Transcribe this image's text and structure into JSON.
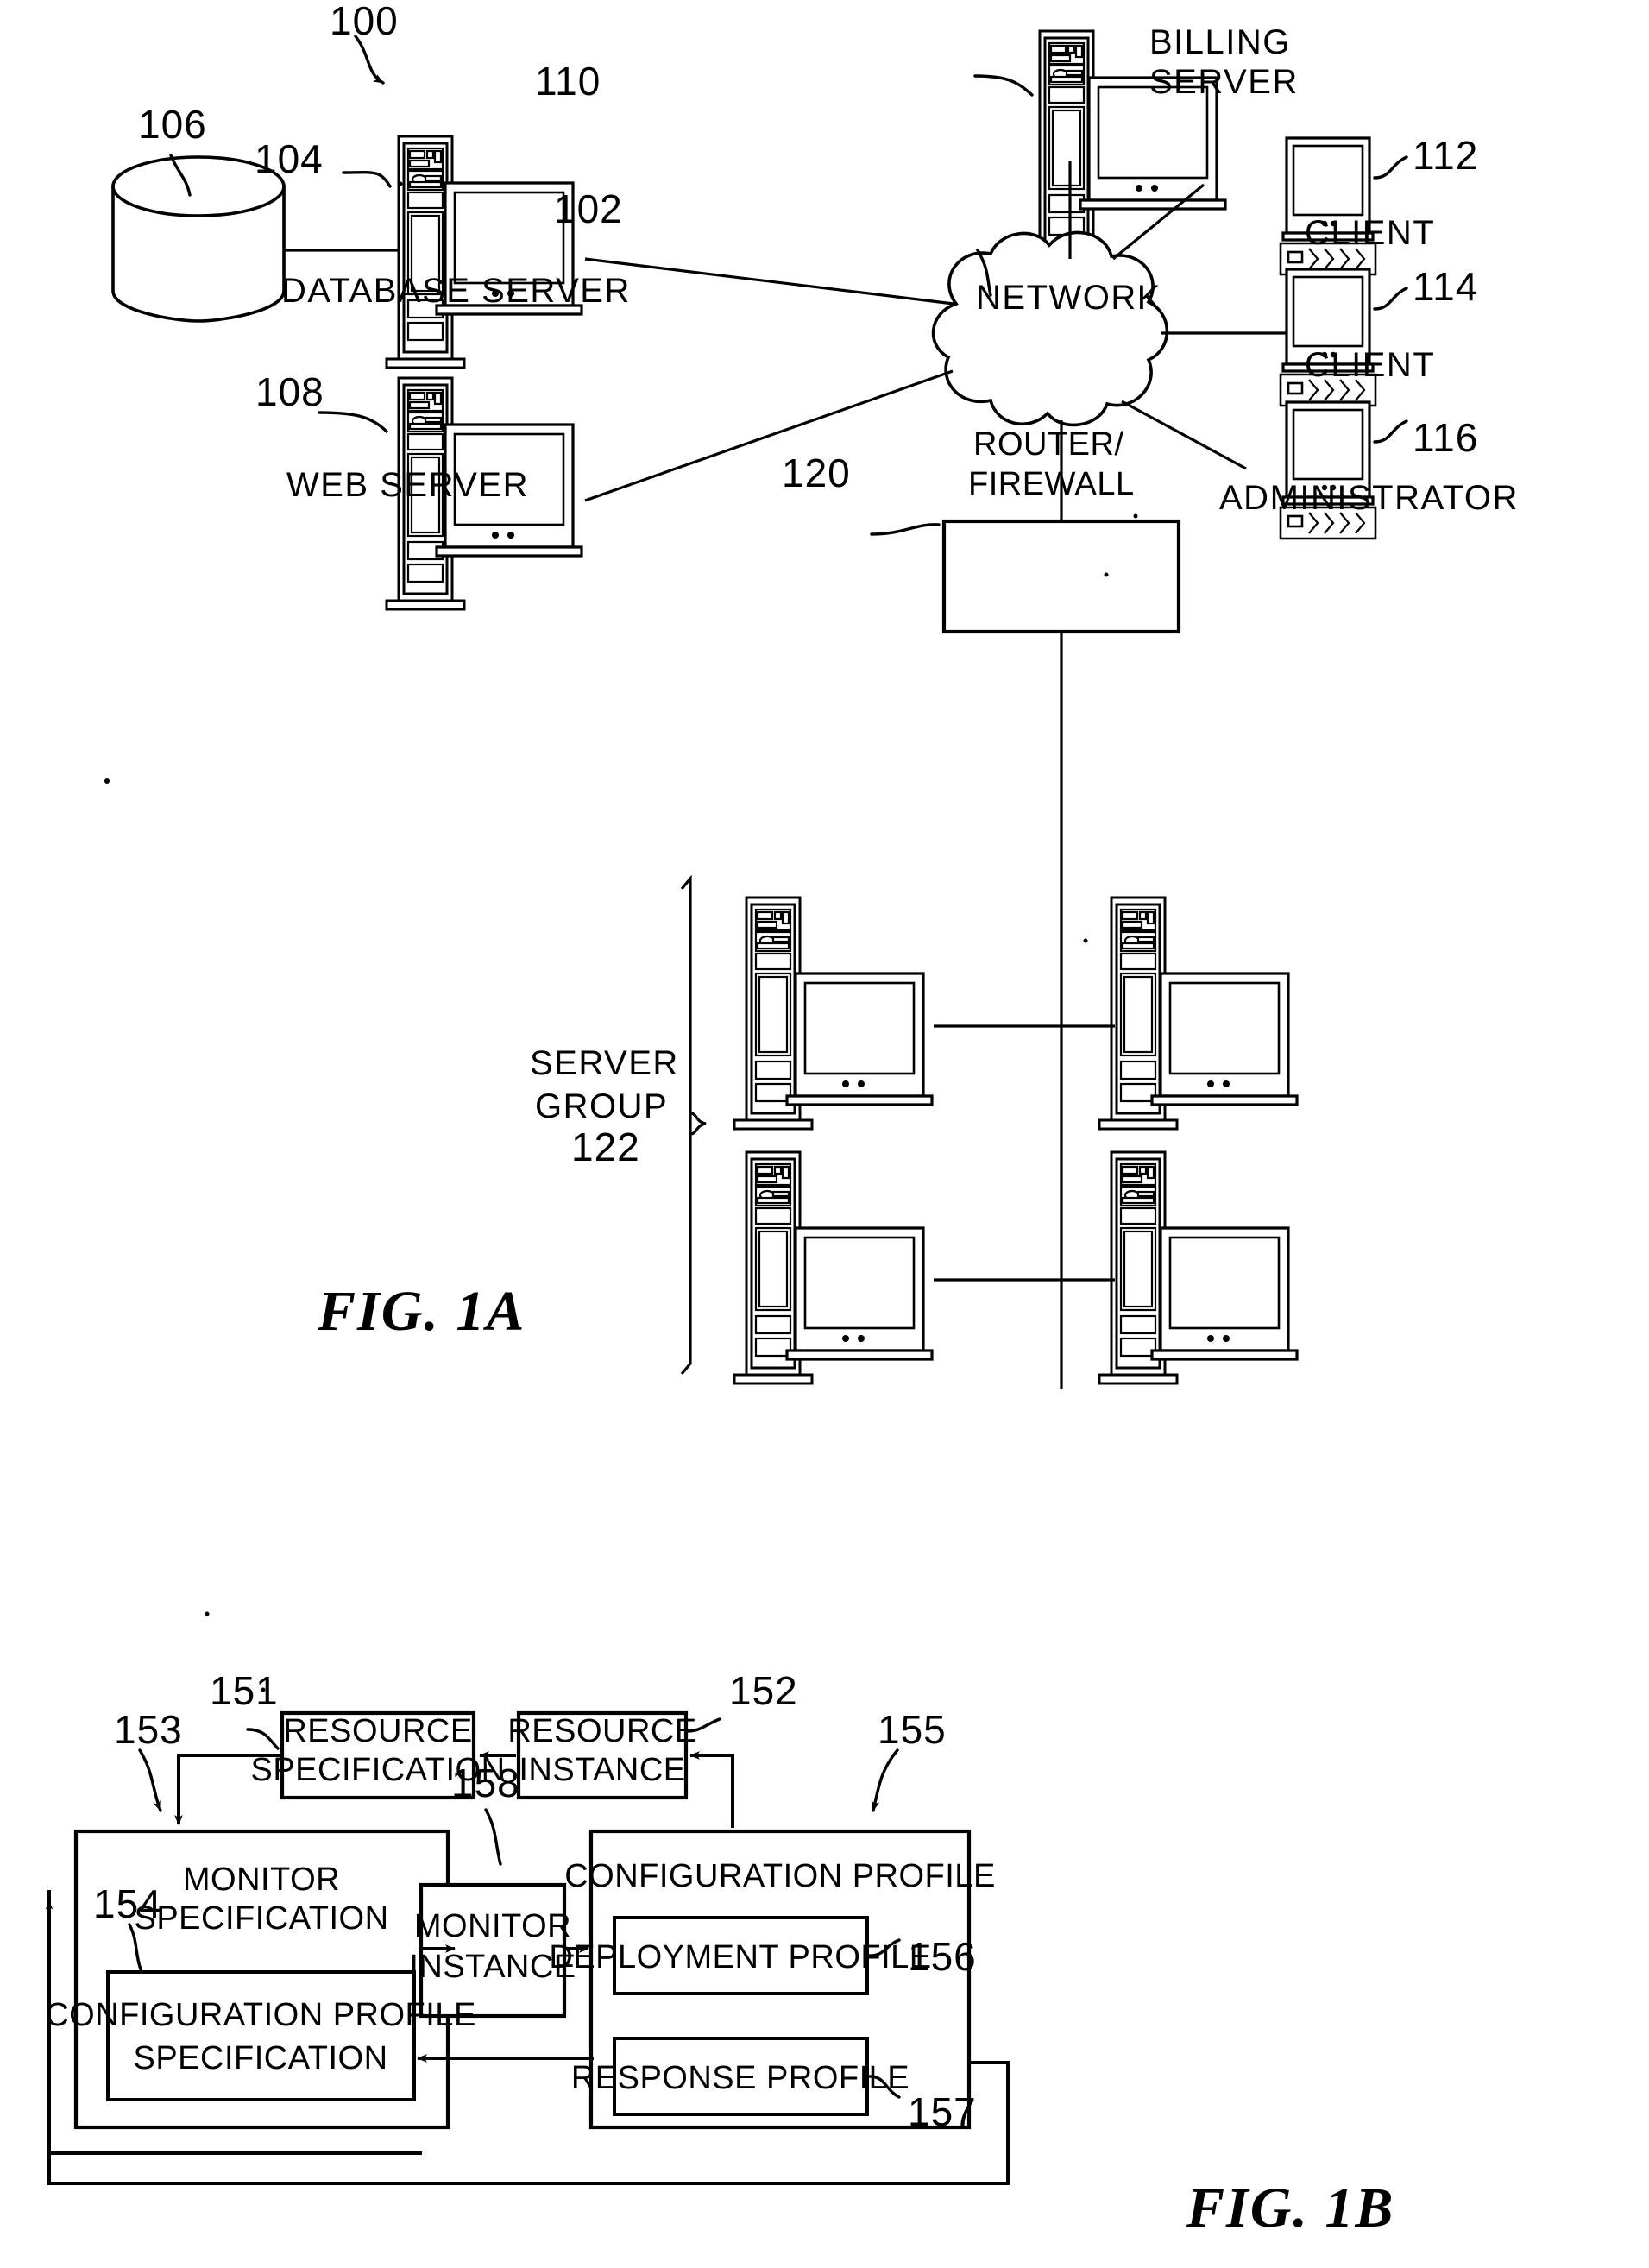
{
  "figures": [
    {
      "id": "fig-1a",
      "caption": "FIG. 1A",
      "system_ref": "100",
      "nodes": [
        {
          "ref": "106",
          "label": "",
          "type": "storage-cylinder"
        },
        {
          "ref": "104",
          "label": "DATABASE SERVER",
          "type": "server"
        },
        {
          "ref": "108",
          "label": "WEB SERVER",
          "type": "server"
        },
        {
          "ref": "110",
          "label": "BILLING SERVER",
          "type": "server"
        },
        {
          "ref": "102",
          "label": "NETWORK",
          "type": "cloud"
        },
        {
          "ref": "112",
          "label": "CLIENT",
          "type": "workstation"
        },
        {
          "ref": "114",
          "label": "CLIENT",
          "type": "workstation"
        },
        {
          "ref": "116",
          "label": "ADMINISTRATOR",
          "type": "workstation"
        },
        {
          "ref": "120",
          "label": "ROUTER/ FIREWALL",
          "type": "box"
        },
        {
          "ref": "122",
          "label": "SERVER GROUP",
          "type": "group"
        }
      ],
      "labels": {
        "database_server": "DATABASE SERVER",
        "web_server": "WEB SERVER",
        "billing_server_line1": "BILLING",
        "billing_server_line2": "SERVER",
        "network": "NETWORK",
        "client_1": "CLIENT",
        "client_2": "CLIENT",
        "administrator": "ADMINISTRATOR",
        "router_line1": "ROUTER/",
        "router_line2": "FIREWALL",
        "server_group_line1": "SERVER",
        "server_group_line2": "GROUP"
      },
      "refs": {
        "system": "100",
        "network": "102",
        "database_server": "104",
        "storage": "106",
        "web_server": "108",
        "billing_server": "110",
        "client_1": "112",
        "client_2": "114",
        "administrator": "116",
        "router_firewall": "120",
        "server_group": "122"
      }
    },
    {
      "id": "fig-1b",
      "caption": "FIG. 1B",
      "blocks": {
        "resource_specification_line1": "RESOURCE",
        "resource_specification_line2": "SPECIFICATION",
        "resource_instance_line1": "RESOURCE",
        "resource_instance_line2": "INSTANCE",
        "monitor_specification_line1": "MONITOR",
        "monitor_specification_line2": "SPECIFICATION",
        "configuration_profile_specification_line1": "CONFIGURATION PROFILE",
        "configuration_profile_specification_line2": "SPECIFICATION",
        "monitor_instance_line1": "MONITOR",
        "monitor_instance_line2": "INSTANCE",
        "configuration_profile": "CONFIGURATION PROFILE",
        "deployment_profile": "DEPLOYMENT PROFILE",
        "response_profile": "RESPONSE PROFILE"
      },
      "refs": {
        "resource_specification": "151",
        "resource_instance": "152",
        "monitor_specification": "153",
        "configuration_profile_specification": "154",
        "configuration_profile": "155",
        "deployment_profile": "156",
        "response_profile": "157",
        "monitor_instance": "158"
      }
    }
  ],
  "colors": {
    "ink": "#000000",
    "paper": "#ffffff"
  }
}
